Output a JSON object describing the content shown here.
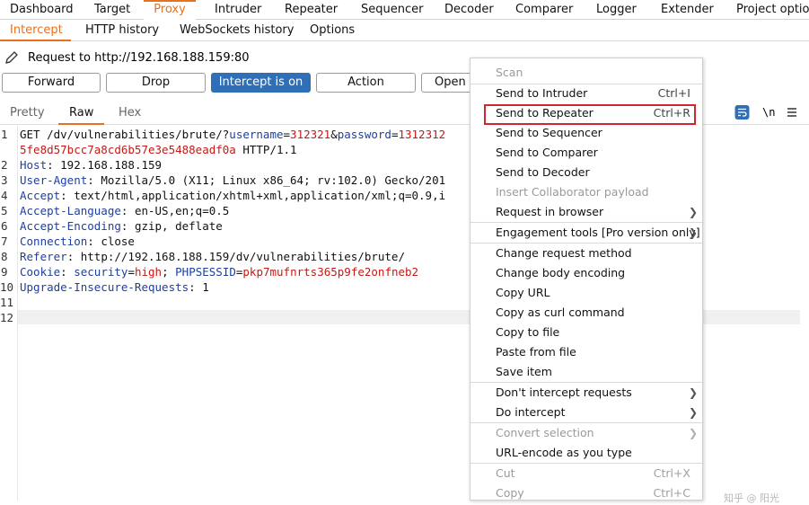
{
  "top_tabs": [
    "Dashboard",
    "Target",
    "Proxy",
    "Intruder",
    "Repeater",
    "Sequencer",
    "Decoder",
    "Comparer",
    "Logger",
    "Extender",
    "Project option"
  ],
  "active_top_tab": "Proxy",
  "sub_tabs": [
    "Intercept",
    "HTTP history",
    "WebSockets history",
    "Options"
  ],
  "active_sub_tab": "Intercept",
  "request_title": "Request to http://192.168.188.159:80",
  "buttons": {
    "forward": "Forward",
    "drop": "Drop",
    "intercept": "Intercept is on",
    "action": "Action",
    "open_browser": "Open B"
  },
  "view_tabs": [
    "Pretty",
    "Raw",
    "Hex"
  ],
  "active_view_tab": "Raw",
  "right_icons": {
    "wrap": "wrap-icon",
    "newline": "\\n",
    "menu": "menu-icon"
  },
  "editor": {
    "line_numbers": [
      "1",
      "",
      "2",
      "3",
      "4",
      "5",
      "6",
      "7",
      "8",
      "9",
      "10",
      "11",
      "12"
    ],
    "l1_method": "GET /dv/vulnerabilities/brute/?",
    "l1_p1": "username",
    "l1_eq1": "=",
    "l1_v1": "312321",
    "l1_amp": "&",
    "l1_p2": "password",
    "l1_eq2": "=",
    "l1_v2": "1312312",
    "l1b_v": "5fe8d57bcc7a8cd6b57e3e5488eadf0a",
    "l1b_rest": " HTTP/1.1",
    "l2_k": "Host",
    "l2_v": ": 192.168.188.159",
    "l3_k": "User-Agent",
    "l3_v": ": Mozilla/5.0 (X11; Linux x86_64; rv:102.0) Gecko/201",
    "l4_k": "Accept",
    "l4_v": ": text/html,application/xhtml+xml,application/xml;q=0.9,i",
    "l5_k": "Accept-Language",
    "l5_v": ": en-US,en;q=0.5",
    "l6_k": "Accept-Encoding",
    "l6_v": ": gzip, deflate",
    "l7_k": "Connection",
    "l7_v": ": close",
    "l8_k": "Referer",
    "l8_v": ": http://192.168.188.159/dv/vulnerabilities/brute/",
    "l9_k": "Cookie",
    "l9_sep": ": ",
    "l9_p1": "security",
    "l9_eq1": "=",
    "l9_v1": "high",
    "l9_semi": "; ",
    "l9_p2": "PHPSESSID",
    "l9_eq2": "=",
    "l9_v2": "pkp7mufnrts365p9fe2onfneb2",
    "l10_k": "Upgrade-Insecure-Requests",
    "l10_v": ": 1"
  },
  "context_menu": {
    "scan": "Scan",
    "send_intruder": "Send to Intruder",
    "send_intruder_sc": "Ctrl+I",
    "send_repeater": "Send to Repeater",
    "send_repeater_sc": "Ctrl+R",
    "send_sequencer": "Send to Sequencer",
    "send_comparer": "Send to Comparer",
    "send_decoder": "Send to Decoder",
    "insert_collab": "Insert Collaborator payload",
    "request_browser": "Request in browser",
    "engagement": "Engagement tools [Pro version only]",
    "change_method": "Change request method",
    "change_body": "Change body encoding",
    "copy_url": "Copy URL",
    "copy_curl": "Copy as curl command",
    "copy_file": "Copy to file",
    "paste_file": "Paste from file",
    "save_item": "Save item",
    "dont_intercept": "Don't intercept requests",
    "do_intercept": "Do intercept",
    "convert_sel": "Convert selection",
    "url_encode": "URL-encode as you type",
    "cut": "Cut",
    "cut_sc": "Ctrl+X",
    "copy": "Copy",
    "copy_sc": "Ctrl+C"
  },
  "watermark": "知乎 @ 阳光"
}
